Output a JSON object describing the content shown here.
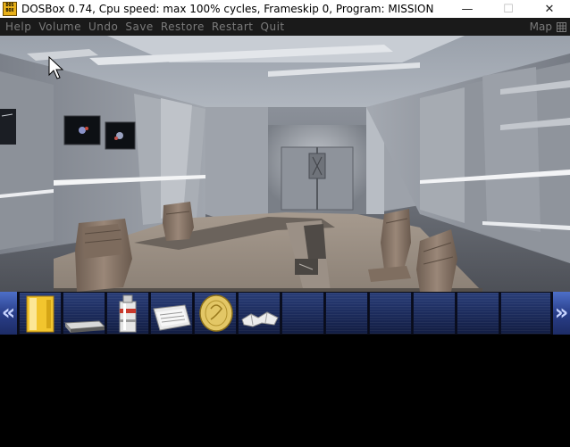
{
  "window": {
    "app_icon_text": "DOS BOX",
    "title": "DOSBox 0.74, Cpu speed: max 100% cycles, Frameskip  0, Program:  MISSION",
    "minimize_glyph": "—",
    "maximize_glyph": "☐",
    "close_glyph": "✕"
  },
  "menubar": {
    "items": [
      "Help",
      "Volume",
      "Undo",
      "Save",
      "Restore",
      "Restart",
      "Quit"
    ],
    "map_label": "Map"
  },
  "scene": {
    "description_icon": "conference-room"
  },
  "inventory": {
    "left_arrow": "«",
    "right_arrow": "»",
    "items": [
      {
        "name": "door-card",
        "icon": "yellow-card-icon"
      },
      {
        "name": "book",
        "icon": "book-icon"
      },
      {
        "name": "canister",
        "icon": "canister-icon"
      },
      {
        "name": "papers",
        "icon": "papers-icon"
      },
      {
        "name": "coin",
        "icon": "gold-coin-icon"
      },
      {
        "name": "note",
        "icon": "crumpled-note-icon"
      }
    ],
    "empty_slots": 6
  },
  "colors": {
    "titlebar_bg": "#ffffff",
    "menubar_bg": "#1a1a1a",
    "menu_text": "#7b7b7b",
    "inventory_slot": "#1f2f66",
    "arrow_blue": "#3b55aa"
  }
}
